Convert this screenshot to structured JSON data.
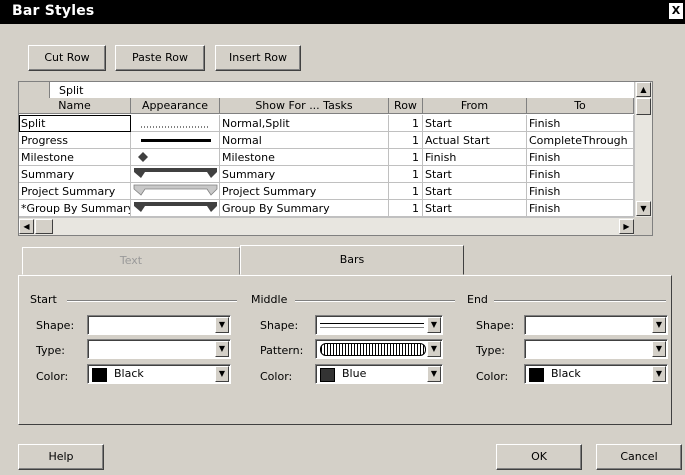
{
  "window": {
    "title": "Bar Styles",
    "close_label": "X"
  },
  "toolbar": {
    "cut_row": "Cut Row",
    "paste_row": "Paste Row",
    "insert_row": "Insert Row"
  },
  "grid": {
    "edit_value": "Split",
    "columns": [
      "Name",
      "Appearance",
      "Show For ... Tasks",
      "Row",
      "From",
      "To"
    ],
    "rows": [
      {
        "name": "Split",
        "appearance": "split-dots",
        "show_for": "Normal,Split",
        "row": "1",
        "from": "Start",
        "to": "Finish"
      },
      {
        "name": "Progress",
        "appearance": "progress-line",
        "show_for": "Normal",
        "row": "1",
        "from": "Actual Start",
        "to": "CompleteThrough"
      },
      {
        "name": "Milestone",
        "appearance": "milestone-diamond",
        "show_for": "Milestone",
        "row": "1",
        "from": "Finish",
        "to": "Finish"
      },
      {
        "name": "Summary",
        "appearance": "summary-bar",
        "show_for": "Summary",
        "row": "1",
        "from": "Start",
        "to": "Finish"
      },
      {
        "name": "Project Summary",
        "appearance": "project-summary-bar",
        "show_for": "Project Summary",
        "row": "1",
        "from": "Start",
        "to": "Finish"
      },
      {
        "name": "*Group By Summary",
        "appearance": "group-summary-bar",
        "show_for": "Group By Summary",
        "row": "1",
        "from": "Start",
        "to": "Finish"
      }
    ]
  },
  "tabs": {
    "text": "Text",
    "bars": "Bars"
  },
  "start": {
    "heading": "Start",
    "shape_label": "Shape:",
    "type_label": "Type:",
    "color_label": "Color:",
    "color_value": "Black"
  },
  "middle": {
    "heading": "Middle",
    "shape_label": "Shape:",
    "pattern_label": "Pattern:",
    "color_label": "Color:",
    "color_value": "Blue"
  },
  "end": {
    "heading": "End",
    "shape_label": "Shape:",
    "type_label": "Type:",
    "color_label": "Color:",
    "color_value": "Black"
  },
  "footer": {
    "help": "Help",
    "ok": "OK",
    "cancel": "Cancel"
  },
  "colors": {
    "titlebar": "#000000",
    "face": "#d4d0c8",
    "bar_dark": "#404040"
  }
}
